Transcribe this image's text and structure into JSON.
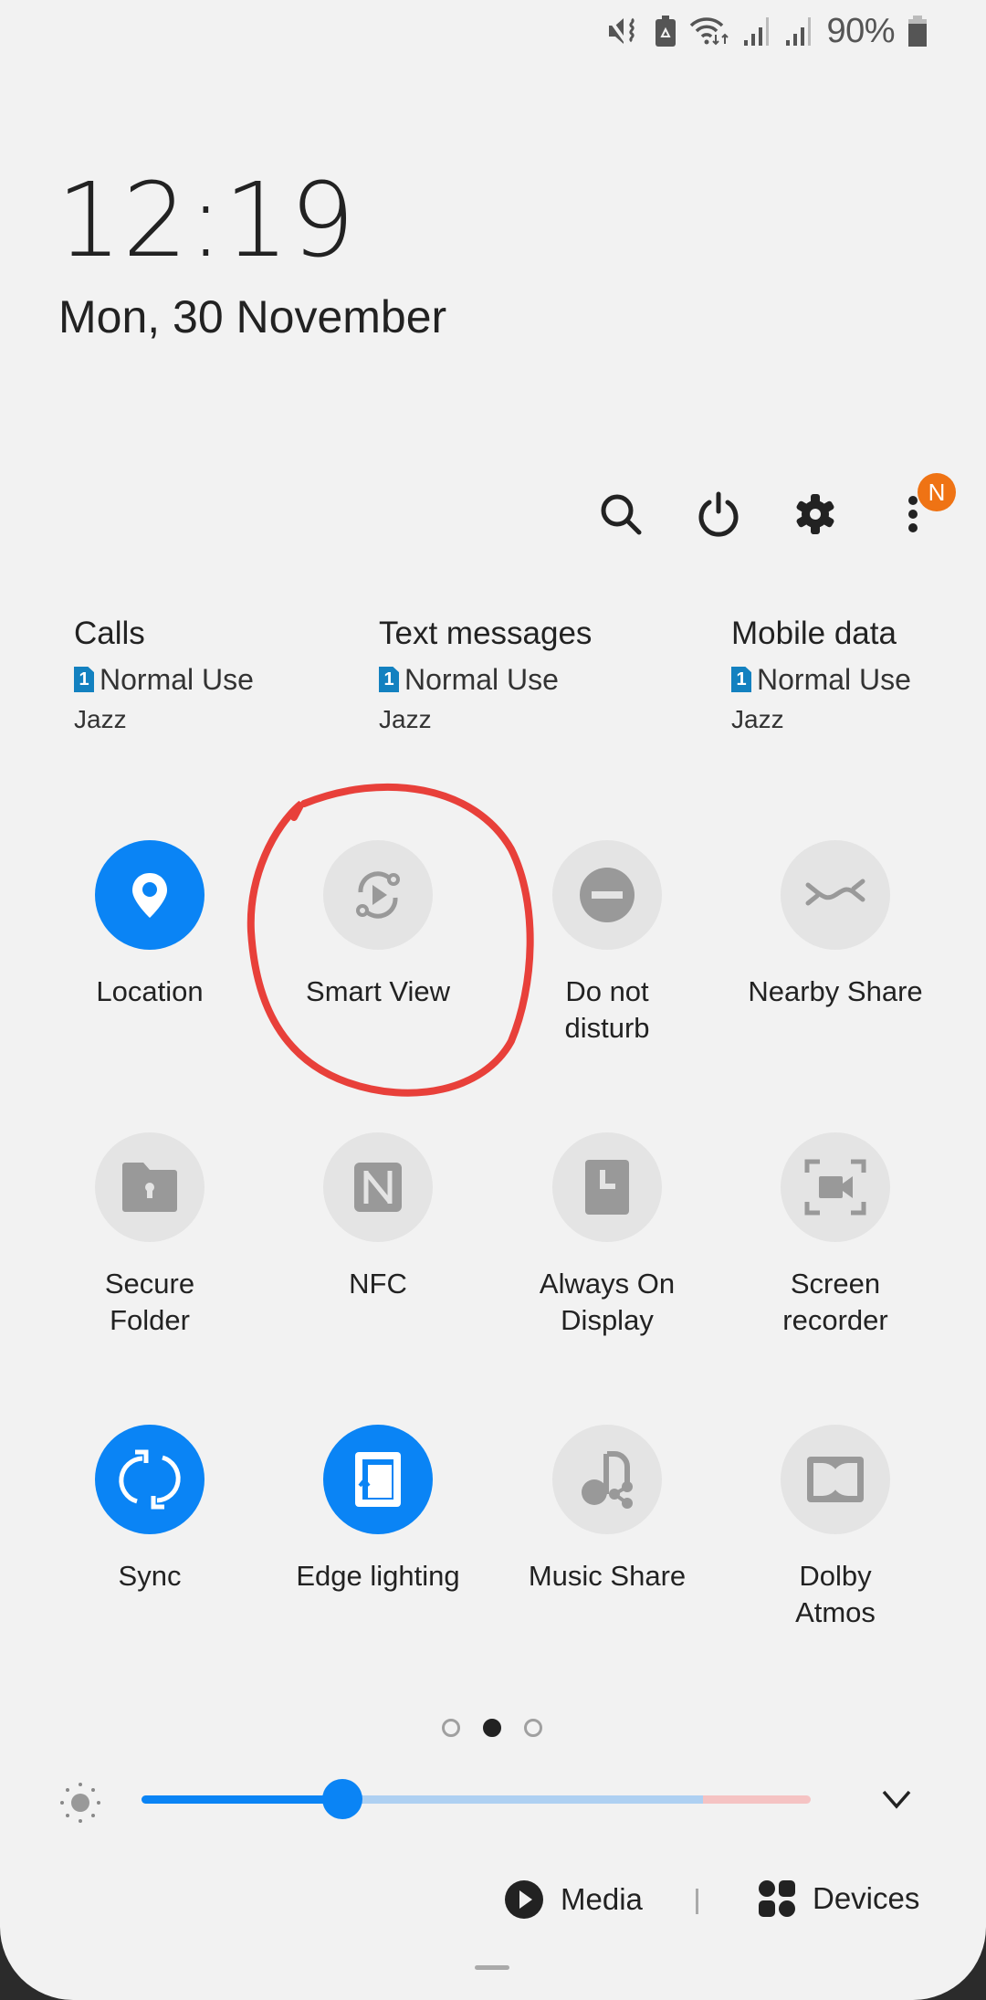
{
  "status_bar": {
    "icons": [
      "vibrate-mute-icon",
      "battery-saver-icon",
      "wifi-data-icon",
      "signal-sim1-icon",
      "signal-sim2-icon",
      "battery-icon"
    ],
    "battery_percent": "90%"
  },
  "lockinfo": {
    "time": "12:19",
    "date": "Mon, 30 November"
  },
  "actions": {
    "icons": [
      "search-icon",
      "power-icon",
      "settings-icon",
      "more-options-icon"
    ],
    "notification_badge": "N",
    "badge_color": "#ef7314"
  },
  "sim_info": [
    {
      "title": "Calls",
      "sim_number": "1",
      "mode": "Normal Use",
      "carrier": "Jazz"
    },
    {
      "title": "Text messages",
      "sim_number": "1",
      "mode": "Normal Use",
      "carrier": "Jazz"
    },
    {
      "title": "Mobile data",
      "sim_number": "1",
      "mode": "Normal Use",
      "carrier": "Jazz"
    }
  ],
  "quick_tiles": [
    {
      "label": "Location",
      "icon": "location-pin-icon",
      "active": true
    },
    {
      "label": "Smart View",
      "icon": "smart-view-icon",
      "active": false
    },
    {
      "label": "Do not\ndisturb",
      "icon": "do-not-disturb-icon",
      "active": false
    },
    {
      "label": "Nearby Share",
      "icon": "nearby-share-icon",
      "active": false
    },
    {
      "label": "Secure\nFolder",
      "icon": "secure-folder-icon",
      "active": false
    },
    {
      "label": "NFC",
      "icon": "nfc-icon",
      "active": false
    },
    {
      "label": "Always On\nDisplay",
      "icon": "always-on-display-icon",
      "active": false
    },
    {
      "label": "Screen\nrecorder",
      "icon": "screen-recorder-icon",
      "active": false
    },
    {
      "label": "Sync",
      "icon": "sync-icon",
      "active": true
    },
    {
      "label": "Edge lighting",
      "icon": "edge-lighting-icon",
      "active": true
    },
    {
      "label": "Music Share",
      "icon": "music-share-icon",
      "active": false
    },
    {
      "label": "Dolby\nAtmos",
      "icon": "dolby-atmos-icon",
      "active": false
    }
  ],
  "pager": {
    "pages": 3,
    "current": 2
  },
  "brightness": {
    "value_fraction": 0.3,
    "accent": "#0a84f5"
  },
  "bottom_bar": {
    "media_label": "Media",
    "devices_label": "Devices"
  },
  "annotation": {
    "circled_tile": "Smart View",
    "color": "#e8403a"
  },
  "colors": {
    "active_tile": "#0a84f5",
    "inactive_tile": "#e4e4e4",
    "background": "#f2f2f2"
  }
}
